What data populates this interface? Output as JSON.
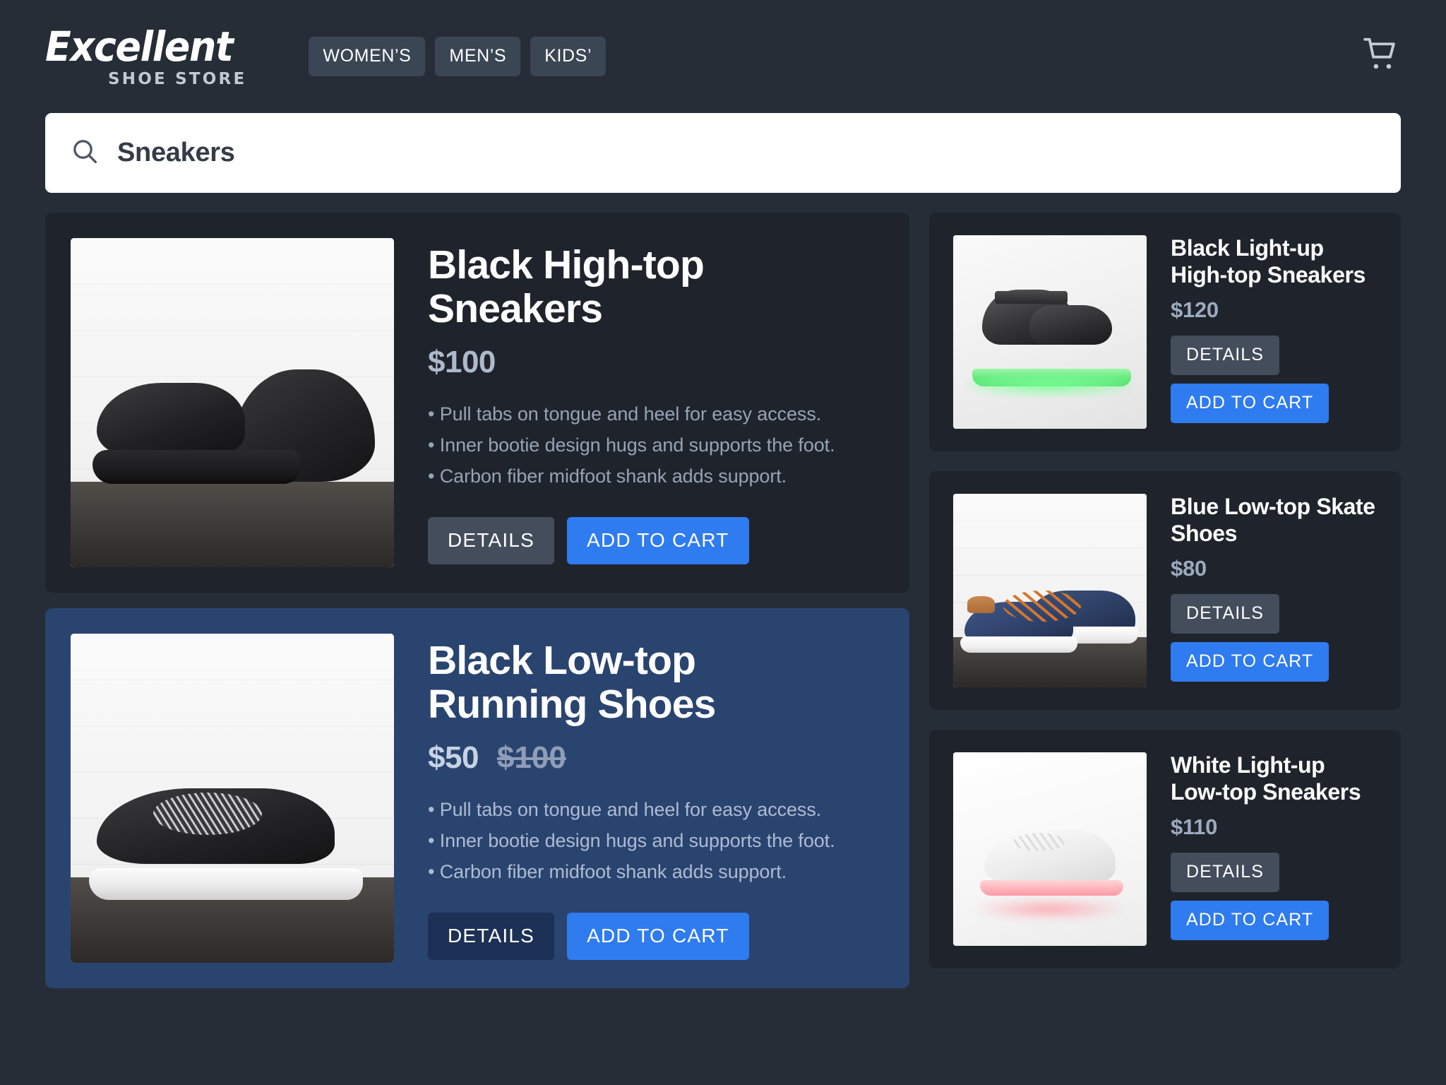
{
  "brand": {
    "name": "Excellent",
    "tagline": "SHOE STORE"
  },
  "header": {
    "nav": [
      {
        "label": "WOMEN’S",
        "name": "nav-womens"
      },
      {
        "label": "MEN’S",
        "name": "nav-mens"
      },
      {
        "label": "KIDS’",
        "name": "nav-kids"
      }
    ],
    "cart_icon": "shopping-cart-icon"
  },
  "search": {
    "icon": "search-icon",
    "value": "Sneakers",
    "placeholder": "Search"
  },
  "colors": {
    "page_background": "#262d36",
    "card_background": "#1f242c",
    "highlight_card_background": "#2a4470",
    "accent_blue": "#2f7bf0",
    "details_button": "#434d5b",
    "details_button_highlight": "#1d3055",
    "price_text": "#9cabbf",
    "body_text": "#97a3b4",
    "search_background": "#ffffff",
    "search_text": "#343c47"
  },
  "buttons": {
    "details_label": "DETAILS",
    "add_to_cart_label": "ADD TO CART"
  },
  "features": [
    {
      "title": "Black High-top Sneakers",
      "price": "$100",
      "old_price": "",
      "highlighted": false,
      "bullets": [
        "Pull tabs on tongue and heel for easy access.",
        "Inner bootie design hugs and supports the foot.",
        "Carbon fiber midfoot shank adds support."
      ],
      "image_alt": "black-high-top-sneakers-photo"
    },
    {
      "title": "Black Low-top Running Shoes",
      "price": "$50",
      "old_price": "$100",
      "highlighted": true,
      "bullets": [
        "Pull tabs on tongue and heel for easy access.",
        "Inner bootie design hugs and supports the foot.",
        "Carbon fiber midfoot shank adds support."
      ],
      "image_alt": "black-low-top-running-shoes-photo"
    }
  ],
  "sidebar_products": [
    {
      "title": "Black Light-up High-top Sneakers",
      "price": "$120",
      "image_alt": "black-light-up-high-top-sneakers-photo"
    },
    {
      "title": "Blue Low-top Skate Shoes",
      "price": "$80",
      "image_alt": "blue-low-top-skate-shoes-photo"
    },
    {
      "title": "White Light-up Low-top Sneakers",
      "price": "$110",
      "image_alt": "white-light-up-low-top-sneakers-photo"
    }
  ]
}
